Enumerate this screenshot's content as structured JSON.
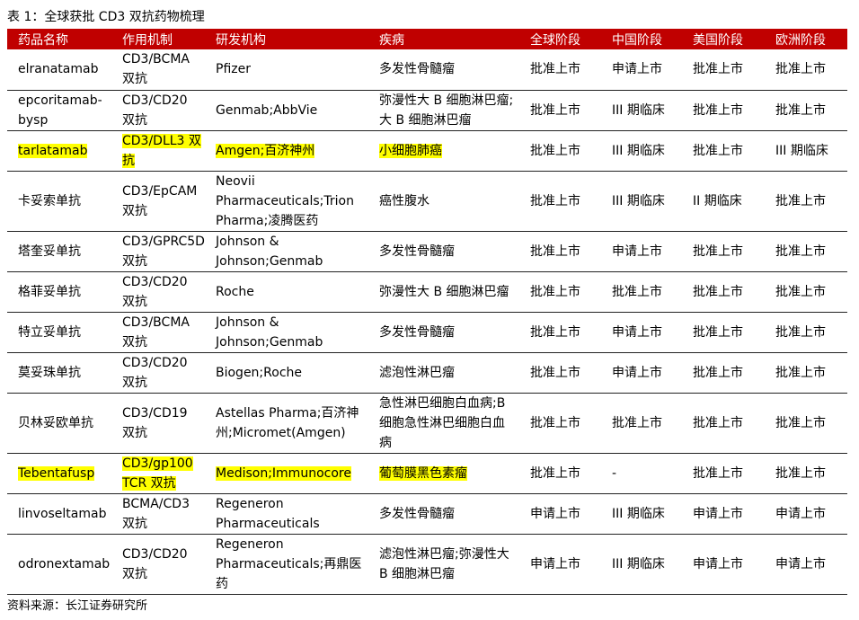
{
  "caption": "表 1：全球获批 CD3 双抗药物梳理",
  "headers": [
    "药品名称",
    "作用机制",
    "研发机构",
    "疾病",
    "全球阶段",
    "中国阶段",
    "美国阶段",
    "欧洲阶段"
  ],
  "rows": [
    {
      "cells": [
        "elranatamab",
        "CD3/BCMA 双抗",
        "Pfizer",
        "多发性骨髓瘤",
        "批准上市",
        "申请上市",
        "批准上市",
        "批准上市"
      ],
      "highlight": [],
      "h": 45
    },
    {
      "cells": [
        "epcoritamab-bysp",
        "CD3/CD20 双抗",
        "Genmab;AbbVie",
        "弥漫性大 B 细胞淋巴瘤;大 B 细胞淋巴瘤",
        "批准上市",
        "III 期临床",
        "批准上市",
        "批准上市"
      ],
      "highlight": [],
      "h": 45
    },
    {
      "cells": [
        "tarlatamab",
        "CD3/DLL3 双抗",
        "Amgen;百济神州",
        "小细胞肺癌",
        "批准上市",
        "III 期临床",
        "批准上市",
        "III 期临床"
      ],
      "highlight": [
        0,
        1,
        2,
        3
      ],
      "h": 45
    },
    {
      "cells": [
        "卡妥索单抗",
        "CD3/EpCAM 双抗",
        "Neovii Pharmaceuticals;Trion Pharma;凌腾医药",
        "癌性腹水",
        "批准上市",
        "III 期临床",
        "II 期临床",
        "批准上市"
      ],
      "highlight": [],
      "h": 67
    },
    {
      "cells": [
        "塔奎妥单抗",
        "CD3/GPRC5D 双抗",
        "Johnson & Johnson;Genmab",
        "多发性骨髓瘤",
        "批准上市",
        "申请上市",
        "批准上市",
        "批准上市"
      ],
      "highlight": [],
      "h": 45
    },
    {
      "cells": [
        "格菲妥单抗",
        "CD3/CD20 双抗",
        "Roche",
        "弥漫性大 B 细胞淋巴瘤",
        "批准上市",
        "批准上市",
        "批准上市",
        "批准上市"
      ],
      "highlight": [],
      "h": 45
    },
    {
      "cells": [
        "特立妥单抗",
        "CD3/BCMA 双抗",
        "Johnson & Johnson;Genmab",
        "多发性骨髓瘤",
        "批准上市",
        "申请上市",
        "批准上市",
        "批准上市"
      ],
      "highlight": [],
      "h": 45
    },
    {
      "cells": [
        "莫妥珠单抗",
        "CD3/CD20 双抗",
        "Biogen;Roche",
        "滤泡性淋巴瘤",
        "批准上市",
        "申请上市",
        "批准上市",
        "批准上市"
      ],
      "highlight": [],
      "h": 45
    },
    {
      "cells": [
        "贝林妥欧单抗",
        "CD3/CD19 双抗",
        "Astellas Pharma;百济神州;Micromet(Amgen)",
        "急性淋巴细胞白血病;B 细胞急性淋巴细胞白血病",
        "批准上市",
        "批准上市",
        "批准上市",
        "批准上市"
      ],
      "highlight": [],
      "h": 66
    },
    {
      "cells": [
        "Tebentafusp",
        "CD3/gp100 TCR 双抗",
        "Medison;Immunocore",
        "葡萄膜黑色素瘤",
        "批准上市",
        "-",
        "批准上市",
        "批准上市"
      ],
      "highlight": [
        0,
        1,
        2,
        3
      ],
      "h": 45
    },
    {
      "cells": [
        "linvoseltamab",
        "BCMA/CD3 双抗",
        "Regeneron Pharmaceuticals",
        "多发性骨髓瘤",
        "申请上市",
        "III 期临床",
        "申请上市",
        "申请上市"
      ],
      "highlight": [],
      "h": 44
    },
    {
      "cells": [
        "odronextamab",
        "CD3/CD20 双抗",
        "Regeneron Pharmaceuticals;再鼎医药",
        "滤泡性淋巴瘤;弥漫性大 B 细胞淋巴瘤",
        "申请上市",
        "III 期临床",
        "申请上市",
        "申请上市"
      ],
      "highlight": [],
      "h": 67
    }
  ],
  "footer": "资料来源：长江证券研究所",
  "colors": {
    "header_bg": "#c00000",
    "header_text": "#ffffff",
    "highlight": "#ffff00"
  }
}
